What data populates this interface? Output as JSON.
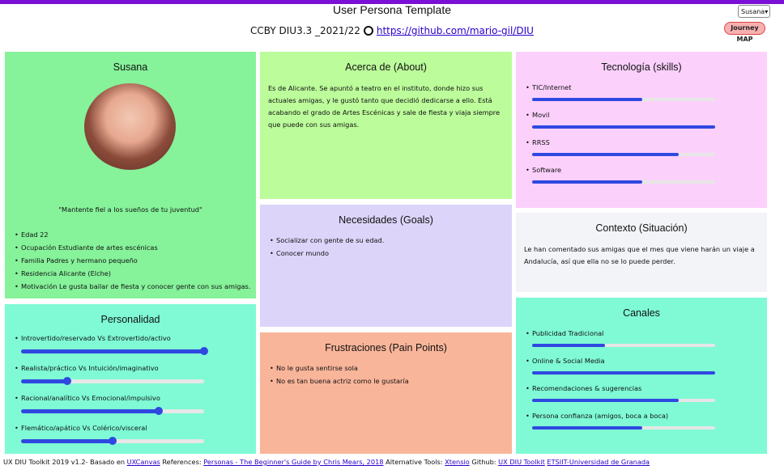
{
  "header": {
    "title": "User Persona Template",
    "subtitle_prefix": "CCBY DIU3.3 _2021/22",
    "repo_link": "https://github.com/mario-gil/DIU",
    "select_value": "Susana",
    "journey_label": "Journey MAP"
  },
  "persona": {
    "name": "Susana",
    "quote": "\"Mantente fiel a los sueños de tu juventud\"",
    "details": [
      "Edad 22",
      "Ocupación Estudiante de artes escénicas",
      "Familia Padres y hermano pequeño",
      "Residencia Alicante (Elche)",
      "Motivación Le gusta bailar de fiesta y conocer gente con sus amigas."
    ]
  },
  "about": {
    "title": "Acerca de (About)",
    "text": "Es de Alicante. Se apuntó a teatro en el instituto, donde hizo sus actuales amigas, y le gustó tanto que decidió dedicarse a ello. Está acabando el grado de Artes Escénicas y sale de fiesta y viaja siempre que puede con sus amigas."
  },
  "skills": {
    "title": "Tecnología (skills)",
    "items": [
      {
        "label": "TIC/Internet",
        "level": 0.6
      },
      {
        "label": "Movil",
        "level": 1.0
      },
      {
        "label": "RRSS",
        "level": 0.8
      },
      {
        "label": "Software",
        "level": 0.6
      }
    ]
  },
  "goals": {
    "title": "Necesidades (Goals)",
    "items": [
      "Socializar con gente de su edad.",
      "Conocer mundo"
    ]
  },
  "context": {
    "title": "Contexto (Situación)",
    "text": "Le han comentado sus amigas que el mes que viene harán un viaje a Andalucía, así que ella no se lo puede perder."
  },
  "personality": {
    "title": "Personalidad",
    "items": [
      {
        "label": "Introvertido/reservado Vs Extrovertido/activo",
        "value": 1.0
      },
      {
        "label": "Realista/práctico Vs Intuición/imaginativo",
        "value": 0.25
      },
      {
        "label": "Racional/analítico Vs Emocional/impulsivo",
        "value": 0.75
      },
      {
        "label": "Flemático/apático Vs Colérico/visceral",
        "value": 0.5
      }
    ]
  },
  "frustrations": {
    "title": "Frustraciones (Pain Points)",
    "items": [
      "No le gusta sentirse sola",
      "No es tan buena actriz como le gustaría"
    ]
  },
  "channels": {
    "title": "Canales",
    "items": [
      {
        "label": "Publicidad Tradicional",
        "level": 0.4
      },
      {
        "label": "Online & Social Media",
        "level": 1.0
      },
      {
        "label": "Recomendaciones & sugerencias",
        "level": 0.8
      },
      {
        "label": "Persona confianza (amigos, boca a boca)",
        "level": 0.6
      }
    ]
  },
  "footer": {
    "prefix": "UX DIU Toolkit 2019 v1.2- Basado en ",
    "link1": "UXCanvas",
    "mid1": " References: ",
    "link2": "Personas - The Beginner's Guide by Chris Mears, 2018",
    "mid2": " Alternative Tools: ",
    "link3": "Xtensio",
    "mid3": " Github: ",
    "link4": "UX DIU Toolkit",
    "mid4": " ",
    "link5": "ETSIIT-Universidad de Granada"
  },
  "colors": {
    "persona": "#86f29a",
    "about": "#bcfc9b",
    "skills": "#fbd0fb",
    "goals": "#dcd4f9",
    "context": "#f3f4f8",
    "personality": "#7ffad5",
    "frustrations": "#f9b59a",
    "channels": "#7ffad5"
  }
}
